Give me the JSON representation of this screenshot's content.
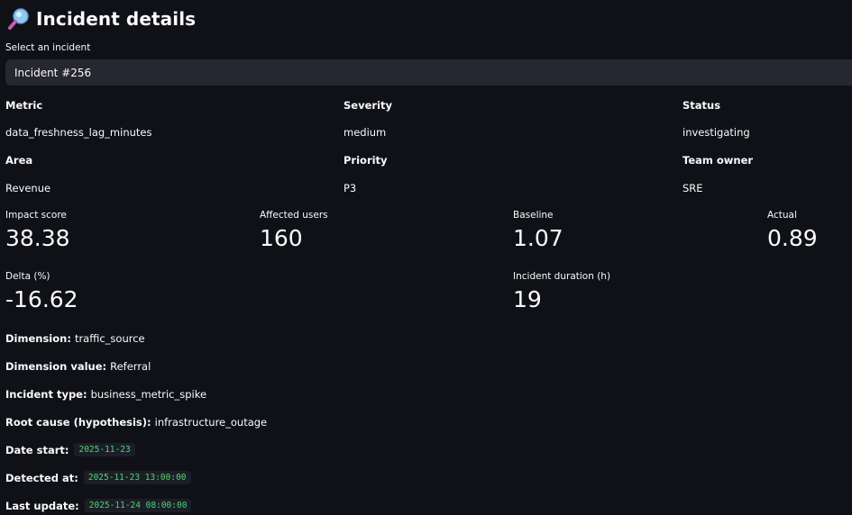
{
  "header": {
    "title": "Incident details",
    "icon": "magnifying-glass-icon"
  },
  "selector": {
    "label": "Select an incident",
    "value": "Incident #256"
  },
  "info": {
    "metric_label": "Metric",
    "metric_value": "data_freshness_lag_minutes",
    "severity_label": "Severity",
    "severity_value": "medium",
    "status_label": "Status",
    "status_value": "investigating",
    "area_label": "Area",
    "area_value": "Revenue",
    "priority_label": "Priority",
    "priority_value": "P3",
    "team_label": "Team owner",
    "team_value": "SRE"
  },
  "metrics": {
    "impact_label": "Impact score",
    "impact_value": "38.38",
    "affected_label": "Affected users",
    "affected_value": "160",
    "baseline_label": "Baseline",
    "baseline_value": "1.07",
    "actual_label": "Actual",
    "actual_value": "0.89",
    "delta_label": "Delta (%)",
    "delta_value": "-16.62",
    "duration_label": "Incident duration (h)",
    "duration_value": "19"
  },
  "details": {
    "dimension_key": "Dimension:",
    "dimension_value": "traffic_source",
    "dimension_value_key": "Dimension value:",
    "dimension_value_value": "Referral",
    "type_key": "Incident type:",
    "type_value": "business_metric_spike",
    "root_key": "Root cause (hypothesis):",
    "root_value": "infrastructure_outage",
    "date_start_key": "Date start:",
    "date_start_value": "2025-11-23",
    "detected_key": "Detected at:",
    "detected_value": "2025-11-23 13:00:00",
    "last_update_key": "Last update:",
    "last_update_value": "2025-11-24 08:00:00"
  },
  "colors": {
    "background": "#0f1117",
    "input_background": "#262730",
    "code_text": "#4fd373",
    "text": "#fafafa"
  }
}
